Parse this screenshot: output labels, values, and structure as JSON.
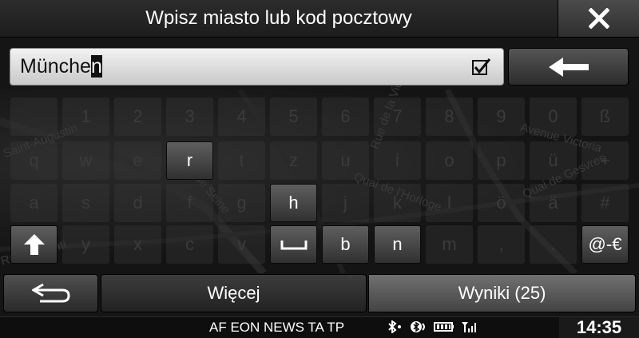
{
  "header": {
    "title": "Wpisz miasto lub kod pocztowy",
    "close_icon": "close-icon"
  },
  "input": {
    "value_prefix": "Münche",
    "value_cursor": "n",
    "check_icon": "checkbox-checked-icon"
  },
  "backspace": {
    "icon": "arrow-left-icon"
  },
  "keyboard": {
    "row1": [
      "",
      "1",
      "2",
      "3",
      "4",
      "5",
      "6",
      "7",
      "8",
      "9",
      "0",
      "ß"
    ],
    "row2": [
      "q",
      "w",
      "e",
      "r",
      "t",
      "z",
      "u",
      "i",
      "o",
      "p",
      "ü",
      "+"
    ],
    "row3": [
      "a",
      "s",
      "d",
      "f",
      "g",
      "h",
      "j",
      "k",
      "l",
      "ö",
      "ä",
      "#"
    ],
    "row4": [
      "⬆",
      "y",
      "x",
      "c",
      "v",
      "␣",
      "b",
      "n",
      "m",
      ",",
      ".",
      "@-€"
    ],
    "active_keys": [
      "r",
      "h",
      "⬆",
      "␣",
      "b",
      "n",
      "@-€"
    ]
  },
  "map_labels": [
    "Saint-Augustin",
    "Rue de la Victoire",
    "Avenue Victoria",
    "Quai de Gesvres",
    "Quai de l'Horloge",
    "Rue Visconti",
    "Rue de Seine"
  ],
  "buttons": {
    "back_icon": "return-arrow-icon",
    "more_label": "Więcej",
    "results_label": "Wyniki (25)"
  },
  "status": {
    "text": "AF EON NEWS TA TP",
    "clock": "14:35",
    "icons": [
      "bluetooth-icon",
      "bluetooth-audio-icon",
      "battery-icon",
      "signal-icon"
    ]
  },
  "colors": {
    "active_key": "#4a4a4a",
    "inactive_key_text": "#3b3b3b",
    "input_bg": "#dedede"
  }
}
